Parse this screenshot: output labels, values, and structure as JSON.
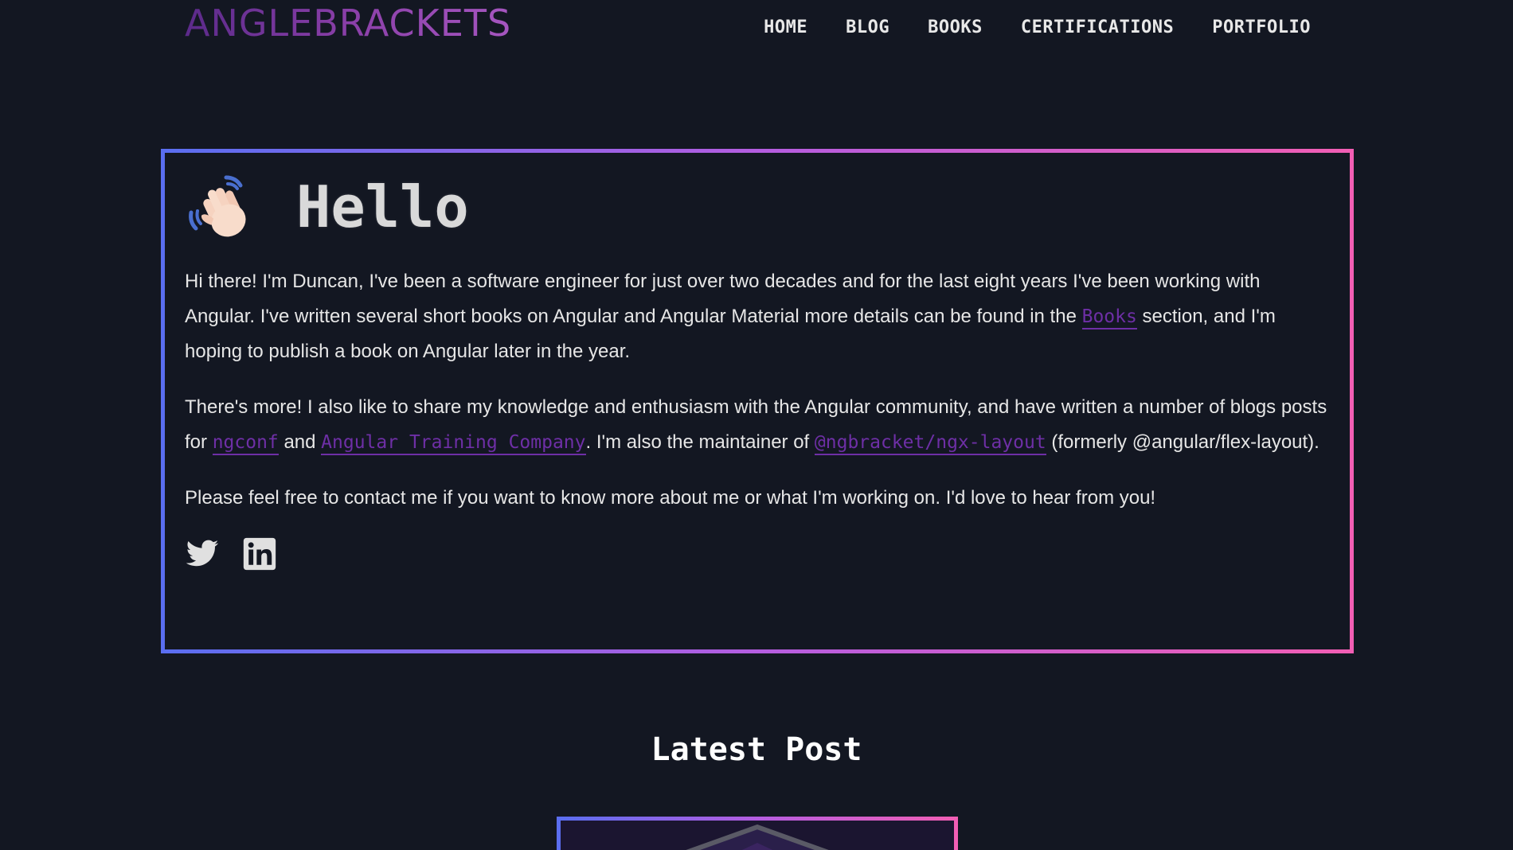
{
  "header": {
    "logo": "ANGLEBRACKETS",
    "nav": [
      "HOME",
      "BLOG",
      "BOOKS",
      "CERTIFICATIONS",
      "PORTFOLIO"
    ]
  },
  "hello": {
    "title": "Hello",
    "icon": "waving-hand-icon",
    "p1_a": "Hi there! I'm Duncan, I've been a software engineer for just over two decades and for the last eight years I've been working with Angular. I've written several short books on Angular and Angular Material more details can be found in the ",
    "p1_link": "Books",
    "p1_b": " section, and I'm hoping to publish a book on Angular later in the year.",
    "p2_a": "There's more! I also like to share my knowledge and enthusiasm with the Angular community, and have written a number of blogs posts for ",
    "p2_link1": "ngconf",
    "p2_b": " and ",
    "p2_link2": "Angular Training Company",
    "p2_c": ". I'm also the maintainer of ",
    "p2_link3": "@ngbracket/ngx-layout",
    "p2_d": " (formerly @angular/flex-layout).",
    "p3": "Please feel free to contact me if you want to know more about me or what I'm working on. I'd love to hear from you!",
    "social": [
      "twitter-icon",
      "linkedin-icon"
    ]
  },
  "latest": {
    "title": "Latest Post"
  },
  "colors": {
    "background": "#131722",
    "link": "#6e2fa6",
    "gradient_start": "#5a6ef0",
    "gradient_end": "#f25eb4"
  }
}
